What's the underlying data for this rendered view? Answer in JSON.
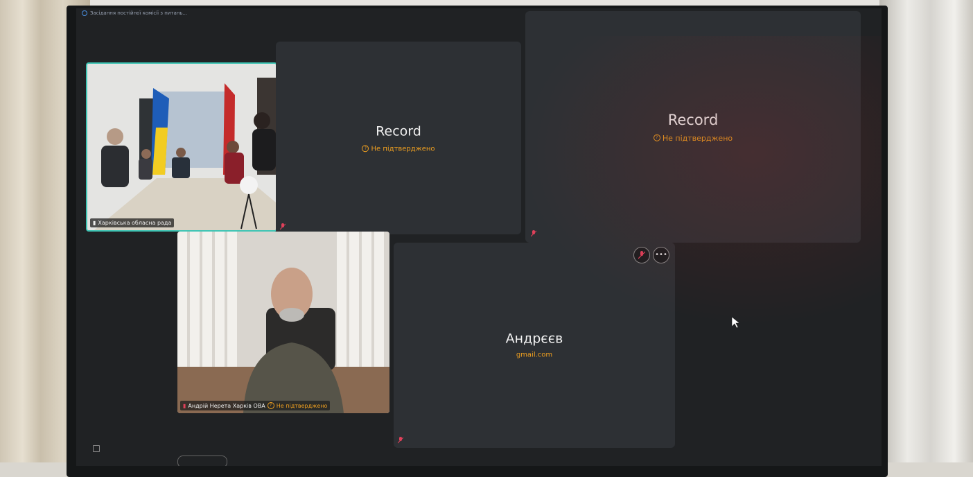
{
  "meeting": {
    "title": "Засідання постійної комісії з питань..."
  },
  "tiles": [
    {
      "name": "Record",
      "status": "Не підтверджено"
    },
    {
      "name": "Record",
      "status": "Не підтверджено"
    },
    {
      "name": "Андрєєв",
      "subtitle": "gmail.com"
    }
  ],
  "video_tiles": [
    {
      "label": "Харківська обласна рада"
    },
    {
      "label": "Андрій Нерета Харків ОВА",
      "status": "Не підтверджено"
    }
  ],
  "controls": {
    "more_label": "•••"
  },
  "colors": {
    "accent": "#3ec4b4",
    "status": "#f0a020",
    "muted": "#e0405a"
  }
}
